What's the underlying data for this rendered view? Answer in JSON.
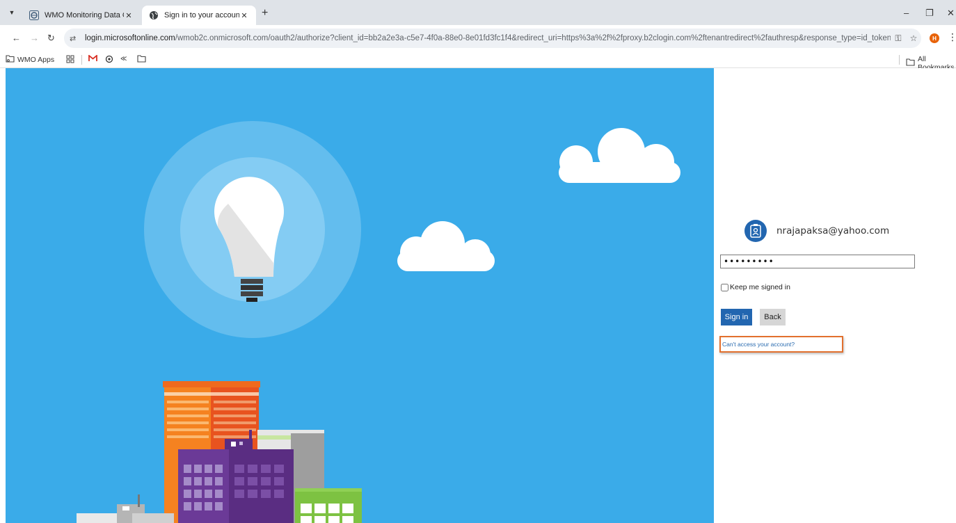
{
  "browser": {
    "tabs": [
      {
        "title": "WMO Monitoring Data Collecti",
        "active": false
      },
      {
        "title": "Sign in to your account",
        "active": true
      }
    ],
    "url_host": "login.microsoftonline.com",
    "url_path": "/wmob2c.onmicrosoft.com/oauth2/authorize?client_id=bb2a2e3a-c5e7-4f0a-88e0-8e01fd3fc1f4&redirect_uri=https%3a%2f%2fproxy.b2clogin.com%2ftenantredirect%2fauthresp&response_type=id_token&scope=email+openid&res...",
    "profile_initial": "H",
    "bookmarks": {
      "wmo_apps": "WMO Apps",
      "all_bookmarks": "All Bookmarks"
    }
  },
  "signin": {
    "username": "nrajapaksa@yahoo.com",
    "password_mask": "•••••••••",
    "keep_signed_in_label": "Keep me signed in",
    "keep_signed_in_checked": false,
    "signin_button": "Sign in",
    "back_button": "Back",
    "cant_access_link": "Can't access your account?"
  },
  "colors": {
    "hero_background": "#3aabe9",
    "primary_button": "#2266b0",
    "highlight_border": "#e2702e"
  }
}
